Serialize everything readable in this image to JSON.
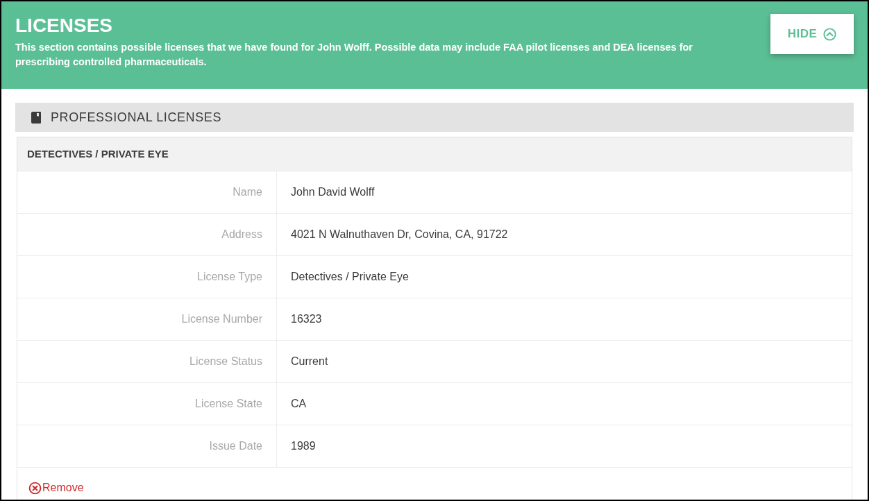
{
  "section": {
    "title": "LICENSES",
    "description": "This section contains possible licenses that we have found for John Wolff. Possible data may include FAA pilot licenses and DEA licenses for prescribing controlled pharmaceuticals.",
    "hide_button": "HIDE"
  },
  "group": {
    "title": "PROFESSIONAL LICENSES"
  },
  "records": [
    {
      "title": "DETECTIVES / PRIVATE EYE",
      "fields": [
        {
          "label": "Name",
          "value": "John David Wolff"
        },
        {
          "label": "Address",
          "value": "4021 N Walnuthaven Dr, Covina, CA, 91722"
        },
        {
          "label": "License Type",
          "value": "Detectives / Private Eye"
        },
        {
          "label": "License Number",
          "value": "16323"
        },
        {
          "label": "License Status",
          "value": "Current"
        },
        {
          "label": "License State",
          "value": "CA"
        },
        {
          "label": "Issue Date",
          "value": "1989"
        }
      ],
      "remove_link": "Remove"
    }
  ]
}
